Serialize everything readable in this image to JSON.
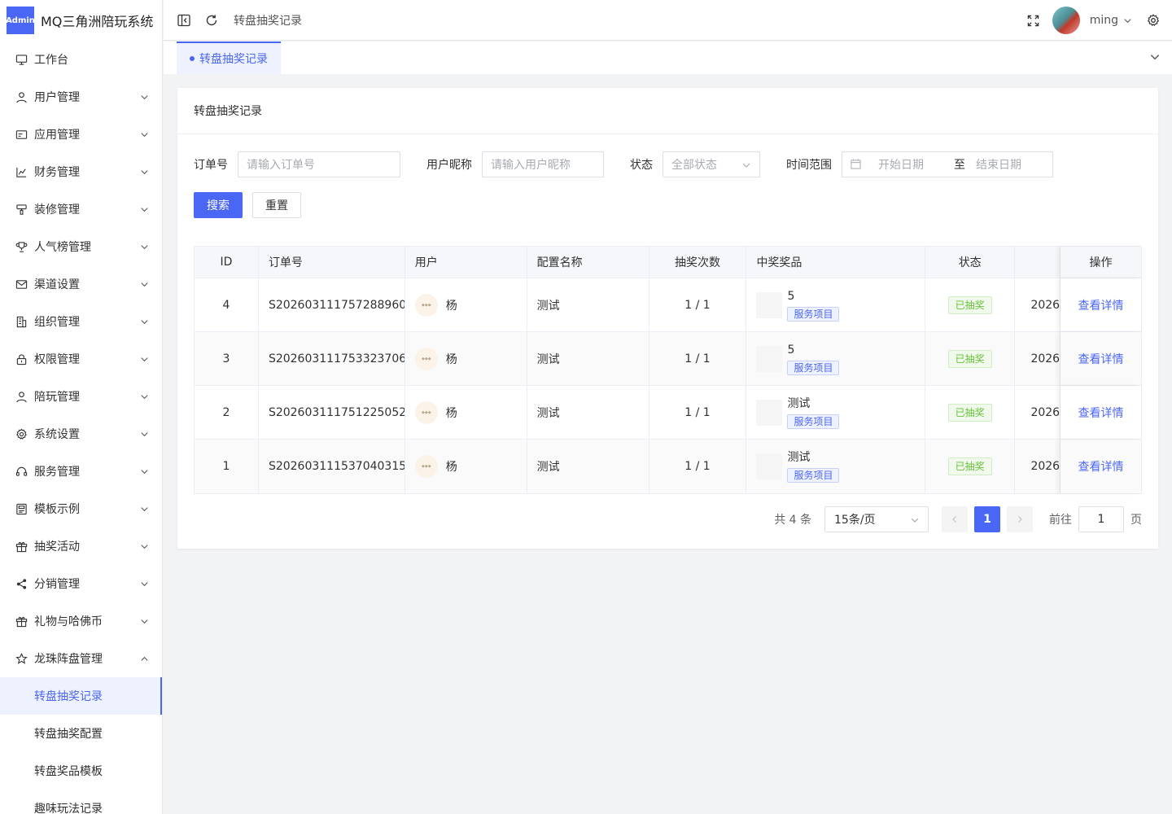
{
  "app": {
    "badge": "Admin",
    "title": "MQ三角洲陪玩系统"
  },
  "sidebar": {
    "items": [
      {
        "label": "工作台",
        "icon": "monitor-icon",
        "arrow": ""
      },
      {
        "label": "用户管理",
        "icon": "user-icon",
        "arrow": "down"
      },
      {
        "label": "应用管理",
        "icon": "app-icon",
        "arrow": "down"
      },
      {
        "label": "财务管理",
        "icon": "chart-icon",
        "arrow": "down"
      },
      {
        "label": "装修管理",
        "icon": "brush-icon",
        "arrow": "down"
      },
      {
        "label": "人气榜管理",
        "icon": "trophy-icon",
        "arrow": "down"
      },
      {
        "label": "渠道设置",
        "icon": "mail-icon",
        "arrow": "down"
      },
      {
        "label": "组织管理",
        "icon": "building-icon",
        "arrow": "down"
      },
      {
        "label": "权限管理",
        "icon": "lock-icon",
        "arrow": "down"
      },
      {
        "label": "陪玩管理",
        "icon": "person-icon",
        "arrow": "down"
      },
      {
        "label": "系统设置",
        "icon": "gear-icon",
        "arrow": "down"
      },
      {
        "label": "服务管理",
        "icon": "headset-icon",
        "arrow": "down"
      },
      {
        "label": "模板示例",
        "icon": "template-icon",
        "arrow": "down"
      },
      {
        "label": "抽奖活动",
        "icon": "gift-icon",
        "arrow": "down"
      },
      {
        "label": "分销管理",
        "icon": "share-icon",
        "arrow": "down"
      },
      {
        "label": "礼物与哈佛币",
        "icon": "gift2-icon",
        "arrow": "down"
      },
      {
        "label": "龙珠阵盘管理",
        "icon": "star-icon",
        "arrow": "up"
      }
    ],
    "subitems": [
      {
        "label": "转盘抽奖记录",
        "active": true
      },
      {
        "label": "转盘抽奖配置",
        "active": false
      },
      {
        "label": "转盘奖品模板",
        "active": false
      },
      {
        "label": "趣味玩法记录",
        "active": false
      }
    ]
  },
  "header": {
    "breadcrumb": "转盘抽奖记录",
    "username": "ming"
  },
  "tabs": [
    {
      "label": "转盘抽奖记录"
    }
  ],
  "card": {
    "title": "转盘抽奖记录"
  },
  "filters": {
    "order_label": "订单号",
    "order_placeholder": "请输入订单号",
    "nick_label": "用户昵称",
    "nick_placeholder": "请输入用户昵称",
    "status_label": "状态",
    "status_value": "全部状态",
    "time_label": "时间范围",
    "start_placeholder": "开始日期",
    "range_sep": "至",
    "end_placeholder": "结束日期",
    "search_btn": "搜索",
    "reset_btn": "重置"
  },
  "table": {
    "columns": [
      "ID",
      "订单号",
      "用户",
      "配置名称",
      "抽奖次数",
      "中奖奖品",
      "状态",
      "",
      "操作"
    ],
    "rows": [
      {
        "id": "4",
        "order": "S202603111757288960",
        "user": "杨",
        "config": "测试",
        "times": "1 / 1",
        "prize": "5",
        "prize_tag": "服务项目",
        "status": "已抽奖",
        "time": "2026",
        "action": "查看详情"
      },
      {
        "id": "3",
        "order": "S202603111753323706",
        "user": "杨",
        "config": "测试",
        "times": "1 / 1",
        "prize": "5",
        "prize_tag": "服务项目",
        "status": "已抽奖",
        "time": "2026",
        "action": "查看详情"
      },
      {
        "id": "2",
        "order": "S202603111751225052",
        "user": "杨",
        "config": "测试",
        "times": "1 / 1",
        "prize": "测试",
        "prize_tag": "服务项目",
        "status": "已抽奖",
        "time": "2026",
        "action": "查看详情"
      },
      {
        "id": "1",
        "order": "S202603111537040315",
        "user": "杨",
        "config": "测试",
        "times": "1 / 1",
        "prize": "测试",
        "prize_tag": "服务项目",
        "status": "已抽奖",
        "time": "2026",
        "action": "查看详情"
      }
    ]
  },
  "pagination": {
    "total": "共 4 条",
    "page_size": "15条/页",
    "current": "1",
    "goto_label": "前往",
    "goto_value": "1",
    "page_unit": "页"
  },
  "colors": {
    "primary": "#4a66f4",
    "success": "#67c23a"
  }
}
